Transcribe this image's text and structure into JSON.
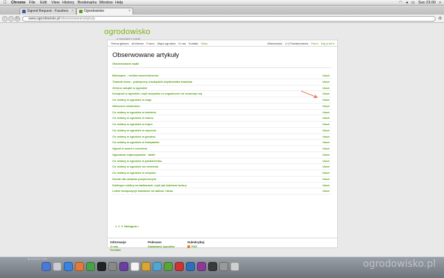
{
  "os_menubar": {
    "app": "Chrome",
    "items": [
      "File",
      "Edit",
      "View",
      "History",
      "Bookmarks",
      "Window",
      "Help"
    ],
    "clock": "Sun 23.00"
  },
  "tabs": [
    {
      "label": "Signed Request - Faceboo",
      "active": false
    },
    {
      "label": "Ogrodowisko",
      "active": true
    }
  ],
  "address_bar": {
    "host": "www.ogrodowisko.pl",
    "path": "/obserwowane/artykuly"
  },
  "site": {
    "logo_main": "ogrodowisko",
    "logo_tag": "o ogrodach z pasją",
    "nav_left": [
      "Strona główna",
      "Archiwum",
      "Forum",
      "Mapa ogrodów",
      "O nas",
      "Kontakt",
      "Sklep"
    ],
    "nav_right": [
      "Wiadomości",
      "(+) Powiadomienia",
      "Panel",
      "Mój profil ▾"
    ],
    "page_title": "Obserwowane artykuły",
    "watched_threads_link": "Obserwowane wątki",
    "remove_label": "Usuń",
    "articles": [
      "Bukszpan – roślina wszechstronna",
      "Trawnik letem - praktyczny niezbędnik użytkownika trawnika",
      "Zielone zakątki w ogrodzie",
      "Kompost w ogrodzie, czyli wszystko co organiczne nie zmarnuje się",
      "Co robimy w ogrodzie w maju",
      "Wiosenne otwieranie",
      "Co robimy w ogrodzie w kwietniu",
      "Co robimy w ogrodzie w marcu",
      "Co robimy w ogrodzie w lutym",
      "Co robimy w ogrodzie w styczniu",
      "Co robimy w ogrodzie w grudniu",
      "Co robimy w ogrodzie w listopadzie",
      "Ogród w szarni i czerwieni",
      "Ogrodowe odpoczywanie - ławki",
      "Co robimy w ogrodzie w październiku",
      "Co robimy w ogrodzie we wrześniu",
      "Co robimy w ogrodzie w sierpniu",
      "Domki dla owadów pożytecznych",
      "Kwitnące rośliny na balkonach, czyli jak dobierać kolory",
      "Letnie kompozycje kwiatowe na balkon i taras"
    ],
    "pagination": {
      "pages": [
        "1",
        "2",
        "3"
      ],
      "next": "Następna »"
    },
    "footer": {
      "col1_title": "Informacje",
      "col1_links": [
        "O nas",
        "Kontakt"
      ],
      "col2_title": "Polecane",
      "col2_links": [
        "Zakładanie ogrodów"
      ],
      "col3_title": "Subskrybuj",
      "col3_links": [
        "RSS"
      ]
    }
  },
  "dock": {
    "magazine_label": "MAGAZINE",
    "watermark": "ogrodowisko.pl"
  },
  "colors": {
    "brand_green": "#4b9b0a",
    "annotation_red": "#e0502a"
  }
}
